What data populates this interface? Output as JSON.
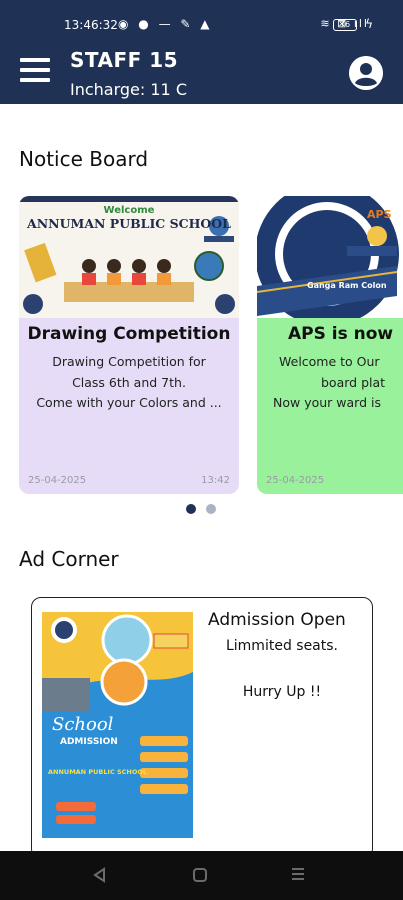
{
  "status_bar": {
    "time": "13:46:32",
    "battery": "76"
  },
  "header": {
    "title": "STAFF 15",
    "subtitle": "Incharge: 11 C"
  },
  "notice_board": {
    "heading": "Notice Board",
    "cards": [
      {
        "image_caption_top": "Welcome",
        "image_caption_main": "ANNUMAN PUBLIC SCHOOL",
        "title": "Drawing Competition",
        "body_lines": [
          "Drawing Competition for",
          "Class 6th and 7th.",
          "Come with your Colors and ..."
        ],
        "date": "25-04-2025",
        "time": "13:42",
        "color": "#e7dcf7"
      },
      {
        "image_caption_main": "APS",
        "image_caption_sub": "Ganga Ram Colon",
        "title": "APS is now",
        "body_lines": [
          "Welcome to Our",
          "board plat",
          "Now your ward is"
        ],
        "date": "25-04-2025",
        "time": "",
        "color": "#99f29b"
      }
    ],
    "pager": {
      "count": 2,
      "active_index": 0
    }
  },
  "ad_corner": {
    "heading": "Ad Corner",
    "card": {
      "image_text_school": "School",
      "image_text_admission": "ADMISSION",
      "image_text_school_name": "ANNUMAN PUBLIC SCHOOL",
      "title": "Admission Open",
      "line1": "Limmited seats.",
      "line2": "Hurry Up !!"
    }
  },
  "colors": {
    "primary": "#1f3256",
    "card1": "#e7dcf7",
    "card2": "#99f29b",
    "ad_blue": "#2c8fd6",
    "ad_yellow": "#f5c43b"
  }
}
